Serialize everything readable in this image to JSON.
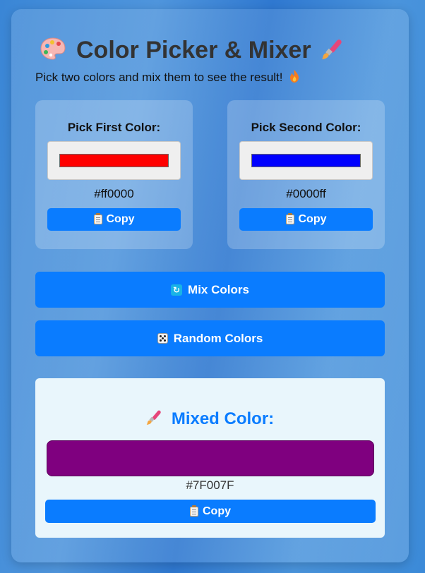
{
  "app": {
    "title": "Color Picker & Mixer",
    "subtitle": "Pick two colors and mix them to see the result!",
    "title_left_icon": "palette-icon",
    "title_right_icon": "paintbrush-icon",
    "subtitle_icon": "fire-icon"
  },
  "pickers": {
    "first": {
      "label": "Pick First Color:",
      "value": "#ff0000",
      "hex_text": "#ff0000",
      "copy_label": "Copy"
    },
    "second": {
      "label": "Pick Second Color:",
      "value": "#0000ff",
      "hex_text": "#0000ff",
      "copy_label": "Copy"
    }
  },
  "actions": {
    "mix_label": "Mix Colors",
    "mix_icon": "cycle-arrows-icon",
    "random_label": "Random Colors",
    "random_icon": "die-icon"
  },
  "result": {
    "title": "Mixed Color:",
    "title_icon": "paintbrush-icon",
    "color": "#7F007F",
    "hex_text": "#7F007F",
    "copy_label": "Copy"
  },
  "colors": {
    "accent": "#0a7cff",
    "title_text": "#333333",
    "result_background": "#e9f6fc"
  }
}
